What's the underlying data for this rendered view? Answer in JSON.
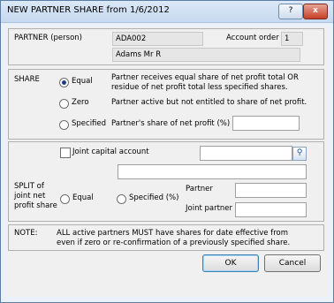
{
  "window": {
    "title": "NEW PARTNER SHARE from 1/6/2012",
    "help_label": "?",
    "close_label": "x"
  },
  "partner": {
    "label": "PARTNER (person)",
    "code": "ADA002",
    "account_order_label": "Account order",
    "account_order": "1",
    "name": "Adams  Mr R"
  },
  "share": {
    "label": "SHARE",
    "selected": "Equal",
    "options": [
      {
        "label": "Equal",
        "description": "Partner receives equal share of net profit total OR residue of net profit total less specified shares."
      },
      {
        "label": "Zero",
        "description": "Partner active but not entitled to share of net profit."
      },
      {
        "label": "Specified",
        "description": "Partner's share of net profit (%)"
      }
    ],
    "specified_value": ""
  },
  "joint_capital": {
    "label": "Joint capital account",
    "checked": false,
    "value": "",
    "description_value": "",
    "lookup_icon": "search-icon"
  },
  "split": {
    "label_line1": "SPLIT of",
    "label_line2": "joint net",
    "label_line3": "profit share",
    "equal_label": "Equal",
    "specified_label": "Specified (%)",
    "partner_label": "Partner",
    "joint_partner_label": "Joint partner",
    "partner_value": "",
    "joint_partner_value": ""
  },
  "note": {
    "label": "NOTE:",
    "text_line1": "ALL active partners MUST have shares for date effective from",
    "text_line2": "even if zero or re-confirmation of a previously specified share."
  },
  "buttons": {
    "ok": "OK",
    "cancel": "Cancel"
  }
}
